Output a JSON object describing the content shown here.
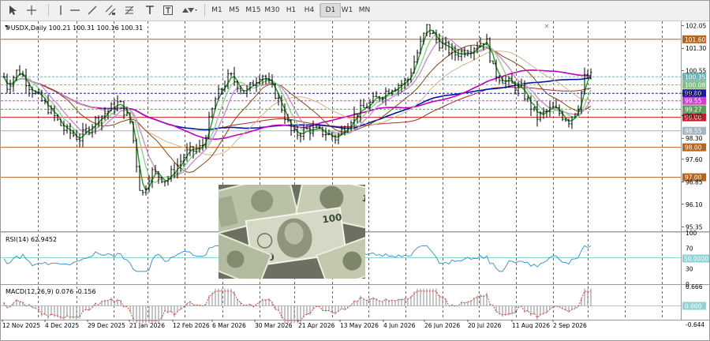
{
  "toolbar": {
    "timeframes": [
      "M1",
      "M5",
      "M15",
      "M30",
      "H1",
      "H4",
      "D1",
      "W1",
      "MN"
    ],
    "active_timeframe": "D1"
  },
  "chart": {
    "header": "#USDX,Daily  100.21 100.31 100.16 100.31",
    "price_ticks": [
      "102.05",
      "101.30",
      "100.55",
      "99.80",
      "99.05",
      "98.30",
      "97.60",
      "96.85",
      "96.10",
      "95.35"
    ],
    "hlines": [
      {
        "label": "101.60",
        "color": "#b5651d",
        "style": "solid"
      },
      {
        "label": "100.35",
        "color": "#6fb3b8",
        "style": "dash"
      },
      {
        "label": "100.08",
        "color": "#7fbf7f",
        "style": "dash"
      },
      {
        "label": "99.80",
        "color": "#1a1aa8",
        "style": "dash"
      },
      {
        "label": "99.55",
        "color": "#d040d0",
        "style": "dash"
      },
      {
        "label": "99.27",
        "color": "#5aa05a",
        "style": "dash"
      },
      {
        "label": "99.00",
        "color": "#c0202a",
        "style": "solid"
      },
      {
        "label": "98.55",
        "color": "#a8b4c0",
        "style": "solid"
      },
      {
        "label": "98.00",
        "color": "#b5651d",
        "style": "solid"
      },
      {
        "label": "97.00",
        "color": "#b5651d",
        "style": "solid"
      }
    ]
  },
  "rsi": {
    "header": "RSI(14) 62.9452",
    "ticks": [
      "100",
      "70",
      "30",
      "0"
    ],
    "level_label": "50.0000"
  },
  "macd": {
    "header": "MACD(12,26,9) 0.076 -0.156",
    "ticks": [
      "0.666",
      "0.000",
      "-0.644"
    ],
    "zero_label": "0.000"
  },
  "dates": [
    "12 Nov 2025",
    "4 Dec 2025",
    "29 Dec 2025",
    "21 Jan 2026",
    "12 Feb 2026",
    "6 Mar 2026",
    "30 Mar 2026",
    "21 Apr 2026",
    "13 May 2026",
    "4 Jun 2026",
    "26 Jun 2026",
    "20 Jul 2026",
    "11 Aug 2026",
    "2 Sep 2026"
  ],
  "colors": {
    "ma_fast": "#1e9e1e",
    "ma_medium": "#8fd08f",
    "ma_slow_brown": "#8b4513",
    "ma_tan": "#d2b48c",
    "ma_blue": "#0018a8",
    "ma_magenta": "#c000c0",
    "ma_red": "#a52a2a",
    "rsi_line": "#1e7fd0",
    "macd_hist": "#a0a0a0",
    "macd_signal": "#d02020"
  }
}
